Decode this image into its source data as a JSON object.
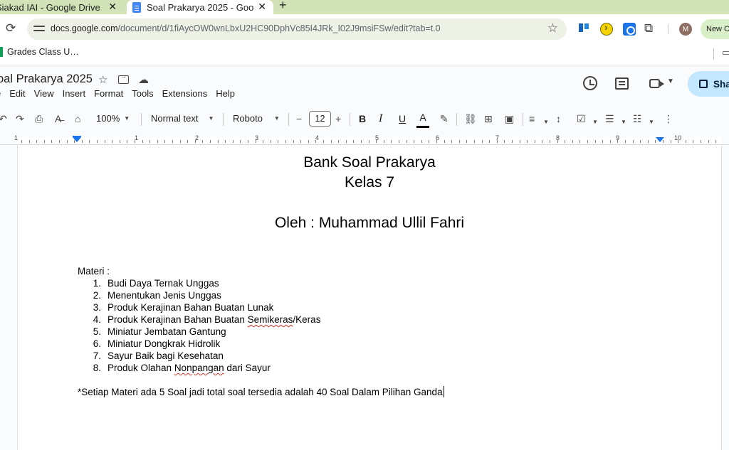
{
  "browser": {
    "tabs": [
      {
        "title": "Siakad IAI - Google Drive",
        "close": "✕"
      },
      {
        "title": "Soal Prakarya 2025 - Goo",
        "close": "✕"
      }
    ],
    "new_tab": "+",
    "url_host": "docs.google.com",
    "url_path": "/document/d/1fiAycOW0wnLbxU2HC90DphVc85I4JRk_I02J9msiFSw/edit?tab=t.0",
    "avatar_letter": "M",
    "new_chrome_label": "New C",
    "bookmark": "Grades Class U…"
  },
  "docs": {
    "title": "oal Prakarya 2025",
    "menu": [
      "e",
      "Edit",
      "View",
      "Insert",
      "Format",
      "Tools",
      "Extensions",
      "Help"
    ],
    "share_label": "Sha"
  },
  "toolbar": {
    "zoom": "100%",
    "style": "Normal text",
    "font": "Roboto",
    "font_size": "12",
    "text_color_glyph": "A"
  },
  "ruler": {
    "numbers": [
      "1",
      "1",
      "2",
      "3",
      "4",
      "5",
      "6",
      "7",
      "8",
      "9",
      "10"
    ]
  },
  "document": {
    "heading1": "Bank Soal Prakarya",
    "heading2": "Kelas 7",
    "heading3": "Oleh : Muhammad Ullil Fahri",
    "materi_label": "Materi :",
    "list": [
      {
        "num": "1.",
        "text": "Budi Daya Ternak Unggas"
      },
      {
        "num": "2.",
        "text": "Menentukan Jenis Unggas"
      },
      {
        "num": "3.",
        "text": "Produk Kerajinan Bahan Buatan Lunak"
      },
      {
        "num": "4.",
        "pre": "Produk Kerajinan Bahan Buatan ",
        "squiggle": "Semikeras",
        "post": "/Keras"
      },
      {
        "num": "5.",
        "text": "Miniatur Jembatan Gantung"
      },
      {
        "num": "6.",
        "text": "Miniatur Dongkrak Hidrolik"
      },
      {
        "num": "7.",
        "text": "Sayur Baik bagi Kesehatan"
      },
      {
        "num": "8.",
        "pre": "Produk Olahan ",
        "squiggle": "Nonpangan",
        "post": " dari Sayur"
      }
    ],
    "note": "*Setiap Materi ada 5 Soal jadi total soal tersedia adalah 40 Soal Dalam Pilihan Ganda"
  },
  "colors": {
    "tab_strip": "#d3e3b8",
    "share_button": "#c2e7ff",
    "ruler_marker": "#1a73e8",
    "spellcheck": "#d93025"
  }
}
